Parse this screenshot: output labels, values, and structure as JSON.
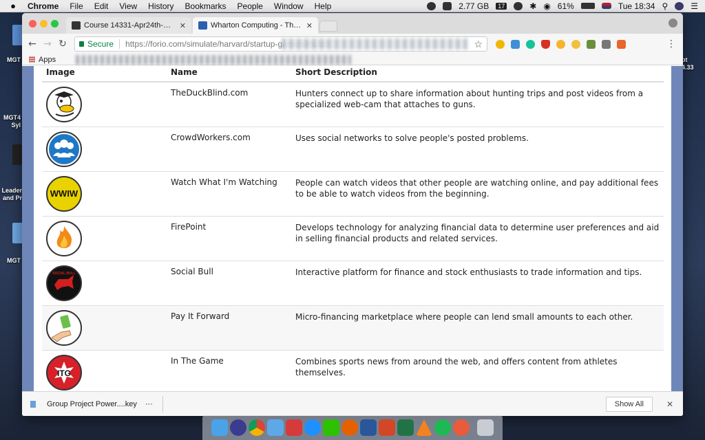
{
  "menubar": {
    "app_name": "Chrome",
    "menus": [
      "File",
      "Edit",
      "View",
      "History",
      "Bookmarks",
      "People",
      "Window",
      "Help"
    ],
    "memory": "2.77 GB",
    "calendar_day": "17",
    "battery": "61%",
    "clock": "Tue 18:34"
  },
  "desktop": {
    "labels": [
      "MGT",
      "MGT4\nSyl",
      "Leader\nand Pr",
      "MGT",
      "pt\n4.33"
    ]
  },
  "tabs": [
    {
      "label": "Course 14331-Apr24th-SecB-f",
      "favicon_color": "#333333"
    },
    {
      "label": "Wharton Computing - The Sta",
      "favicon_color": "#2c5fb0"
    }
  ],
  "address": {
    "secure_label": "Secure",
    "url": "https://forio.com/simulate/harvard/startup-game/simulati"
  },
  "bookmarks": {
    "apps_label": "Apps"
  },
  "table": {
    "headers": {
      "image": "Image",
      "name": "Name",
      "description": "Short Description"
    },
    "rows": [
      {
        "name": "TheDuckBlind.com",
        "description": "Hunters connect up to share information about hunting trips and post videos from a specialized web-cam that attaches to guns.",
        "icon": "duck-icon"
      },
      {
        "name": "CrowdWorkers.com",
        "description": "Uses social networks to solve people's posted problems.",
        "icon": "people-group-icon"
      },
      {
        "name": "Watch What I'm Watching",
        "description": "People can watch videos that other people are watching online, and pay additional fees to be able to watch videos from the beginning.",
        "icon": "www-logo-icon",
        "logo_text": "WWIW"
      },
      {
        "name": "FirePoint",
        "description": "Develops technology for analyzing financial data to determine user preferences and aid in selling financial products and related services.",
        "icon": "flame-icon"
      },
      {
        "name": "Social Bull",
        "description": "Interactive platform for finance and stock enthusiasts to trade information and tips.",
        "icon": "bull-icon",
        "logo_text": "SOCIAL BULL"
      },
      {
        "name": "Pay It Forward",
        "description": "Micro-financing marketplace where people can lend small amounts to each other.",
        "icon": "money-hand-icon"
      },
      {
        "name": "In The Game",
        "description": "Combines sports news from around the web, and offers content from athletes themselves.",
        "icon": "itg-logo-icon",
        "logo_text": "ITG"
      }
    ]
  },
  "downloads": {
    "file_name": "Group Project Power....key",
    "show_all_label": "Show All"
  }
}
